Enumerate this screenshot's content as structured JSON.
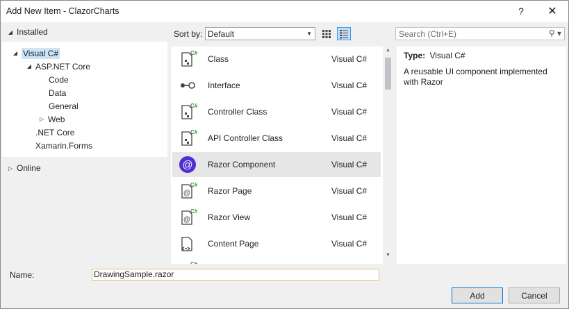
{
  "window": {
    "title": "Add New Item - ClazorCharts",
    "help": "?",
    "close": "✕"
  },
  "tree": {
    "installed": "Installed",
    "items": [
      {
        "label": "Visual C#",
        "expanded": true,
        "selected": true
      },
      {
        "label": "ASP.NET Core",
        "expanded": true
      },
      {
        "label": "Code"
      },
      {
        "label": "Data"
      },
      {
        "label": "General"
      },
      {
        "label": "Web",
        "collapsed": true
      },
      {
        "label": ".NET Core"
      },
      {
        "label": "Xamarin.Forms"
      }
    ],
    "online": "Online"
  },
  "toolbar": {
    "sort_label": "Sort by:",
    "sort_value": "Default",
    "search_placeholder": "Search (Ctrl+E)"
  },
  "templates": [
    {
      "name": "Class",
      "lang": "Visual C#",
      "icon": "csharp-class-icon"
    },
    {
      "name": "Interface",
      "lang": "Visual C#",
      "icon": "interface-icon"
    },
    {
      "name": "Controller Class",
      "lang": "Visual C#",
      "icon": "csharp-class-icon"
    },
    {
      "name": "API Controller Class",
      "lang": "Visual C#",
      "icon": "csharp-class-icon"
    },
    {
      "name": "Razor Component",
      "lang": "Visual C#",
      "icon": "blazor-icon",
      "selected": true
    },
    {
      "name": "Razor Page",
      "lang": "Visual C#",
      "icon": "razor-page-icon"
    },
    {
      "name": "Razor View",
      "lang": "Visual C#",
      "icon": "razor-page-icon"
    },
    {
      "name": "Content Page",
      "lang": "Visual C#",
      "icon": "content-page-icon"
    }
  ],
  "detail": {
    "type_key": "Type:",
    "type_value": "Visual C#",
    "description": "A reusable UI component implemented with Razor"
  },
  "bottom": {
    "name_label": "Name:",
    "name_value": "DrawingSample.razor",
    "add_label": "Add",
    "cancel_label": "Cancel"
  },
  "colors": {
    "selection": "#cce4f7",
    "blazor_purple": "#512bd4",
    "accent": "#0078d7"
  }
}
